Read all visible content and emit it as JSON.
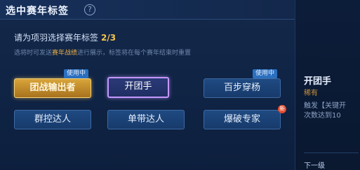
{
  "header": {
    "title": "选中赛年标签",
    "help_glyph": "?"
  },
  "instruction": {
    "text": "请为项羽选择赛年标签",
    "count": "2/3"
  },
  "hint": {
    "before": "选将时可发送",
    "highlight": "赛年战绩",
    "after": "进行展示，标签将在每个赛年结束时重置"
  },
  "tags": [
    {
      "label": "团战输出者",
      "state": "selected-gold",
      "badge": "使用中"
    },
    {
      "label": "开团手",
      "state": "focused",
      "badge": ""
    },
    {
      "label": "百步穿杨",
      "state": "normal",
      "badge": "使用中"
    },
    {
      "label": "群控达人",
      "state": "normal",
      "badge": ""
    },
    {
      "label": "单带达人",
      "state": "normal",
      "badge": ""
    },
    {
      "label": "爆破专家",
      "state": "normal",
      "badge": "",
      "new_badge": "新"
    }
  ],
  "detail": {
    "title": "开团手",
    "rarity": "稀有",
    "desc_line1": "触发【关键开",
    "desc_line2": "次数达到10",
    "next_label": "下一级"
  },
  "colors": {
    "gold": "#d9a53a",
    "purple": "#c497ff",
    "badge_blue": "#2b6fbf",
    "hint_highlight": "#e8b04a"
  }
}
